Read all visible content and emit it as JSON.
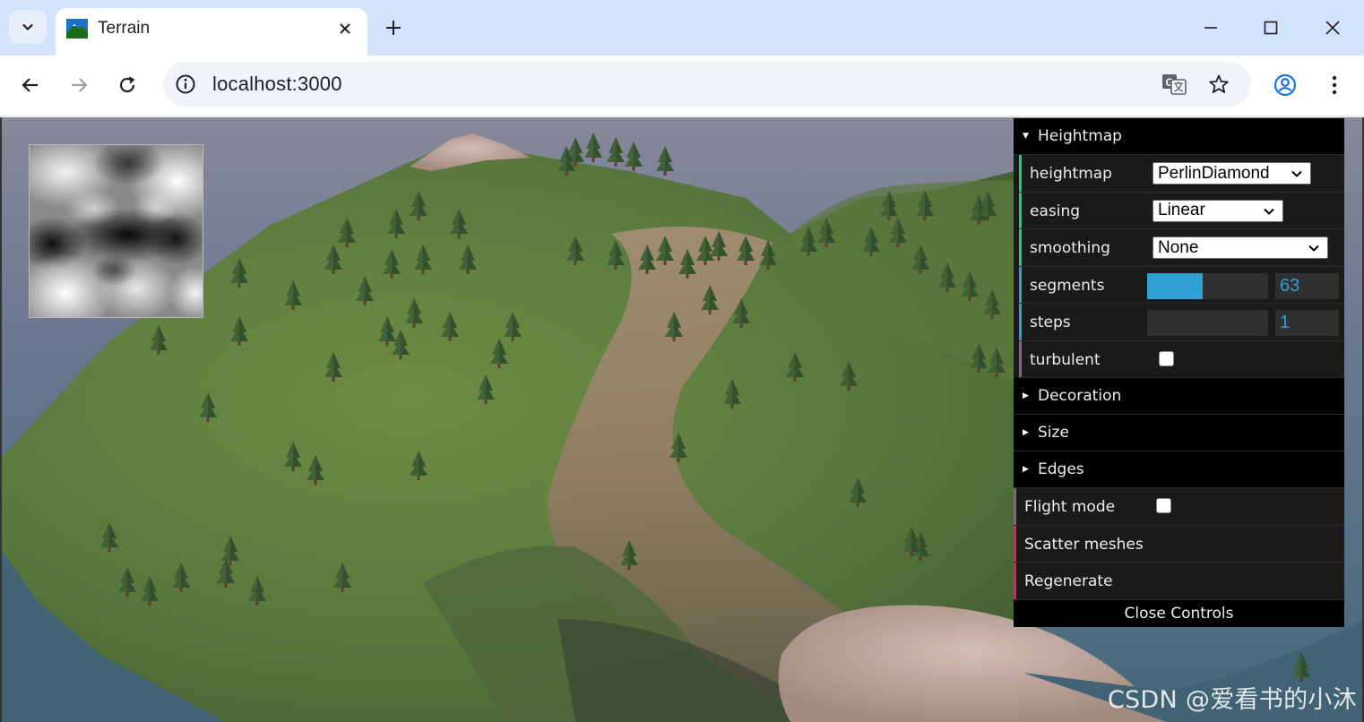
{
  "browser": {
    "tab": {
      "title": "Terrain",
      "favicon": "mountain-favicon-icon"
    },
    "icons": {
      "tab_search": "chevron-down-icon",
      "tab_close": "close-icon",
      "new_tab": "plus-icon",
      "minimize": "minimize-icon",
      "maximize": "maximize-icon",
      "close": "close-icon",
      "back": "arrow-left-icon",
      "forward": "arrow-right-icon",
      "reload": "reload-icon",
      "site_info": "info-icon",
      "translate": "translate-icon",
      "bookmark": "star-icon",
      "profile": "profile-icon",
      "menu": "kebab-menu-icon"
    },
    "url": "localhost:3000"
  },
  "controls": {
    "heightmap_folder": {
      "title": "Heightmap",
      "expanded": true,
      "heightmap": {
        "label": "heightmap",
        "value": "PerlinDiamond"
      },
      "easing": {
        "label": "easing",
        "value": "Linear"
      },
      "smoothing": {
        "label": "smoothing",
        "value": "None"
      },
      "segments": {
        "label": "segments",
        "value": "63",
        "fill_fraction": 0.46
      },
      "steps": {
        "label": "steps",
        "value": "1",
        "fill_fraction": 0
      },
      "turbulent": {
        "label": "turbulent",
        "checked": false
      }
    },
    "folders": [
      {
        "title": "Decoration",
        "expanded": false
      },
      {
        "title": "Size",
        "expanded": false
      },
      {
        "title": "Edges",
        "expanded": false
      }
    ],
    "flight_mode": {
      "label": "Flight mode",
      "checked": false
    },
    "scatter_meshes": {
      "label": "Scatter meshes"
    },
    "regenerate": {
      "label": "Regenerate"
    },
    "close_controls": {
      "label": "Close Controls"
    },
    "colors": {
      "select_bar": "#1ed36f",
      "number_bar": "#2fa1d6",
      "boolean_bar": "#806787",
      "function_bar": "#e61d5f",
      "slider_fill": "#2fa1d6"
    }
  },
  "watermark": "CSDN @爱看书的小沐"
}
